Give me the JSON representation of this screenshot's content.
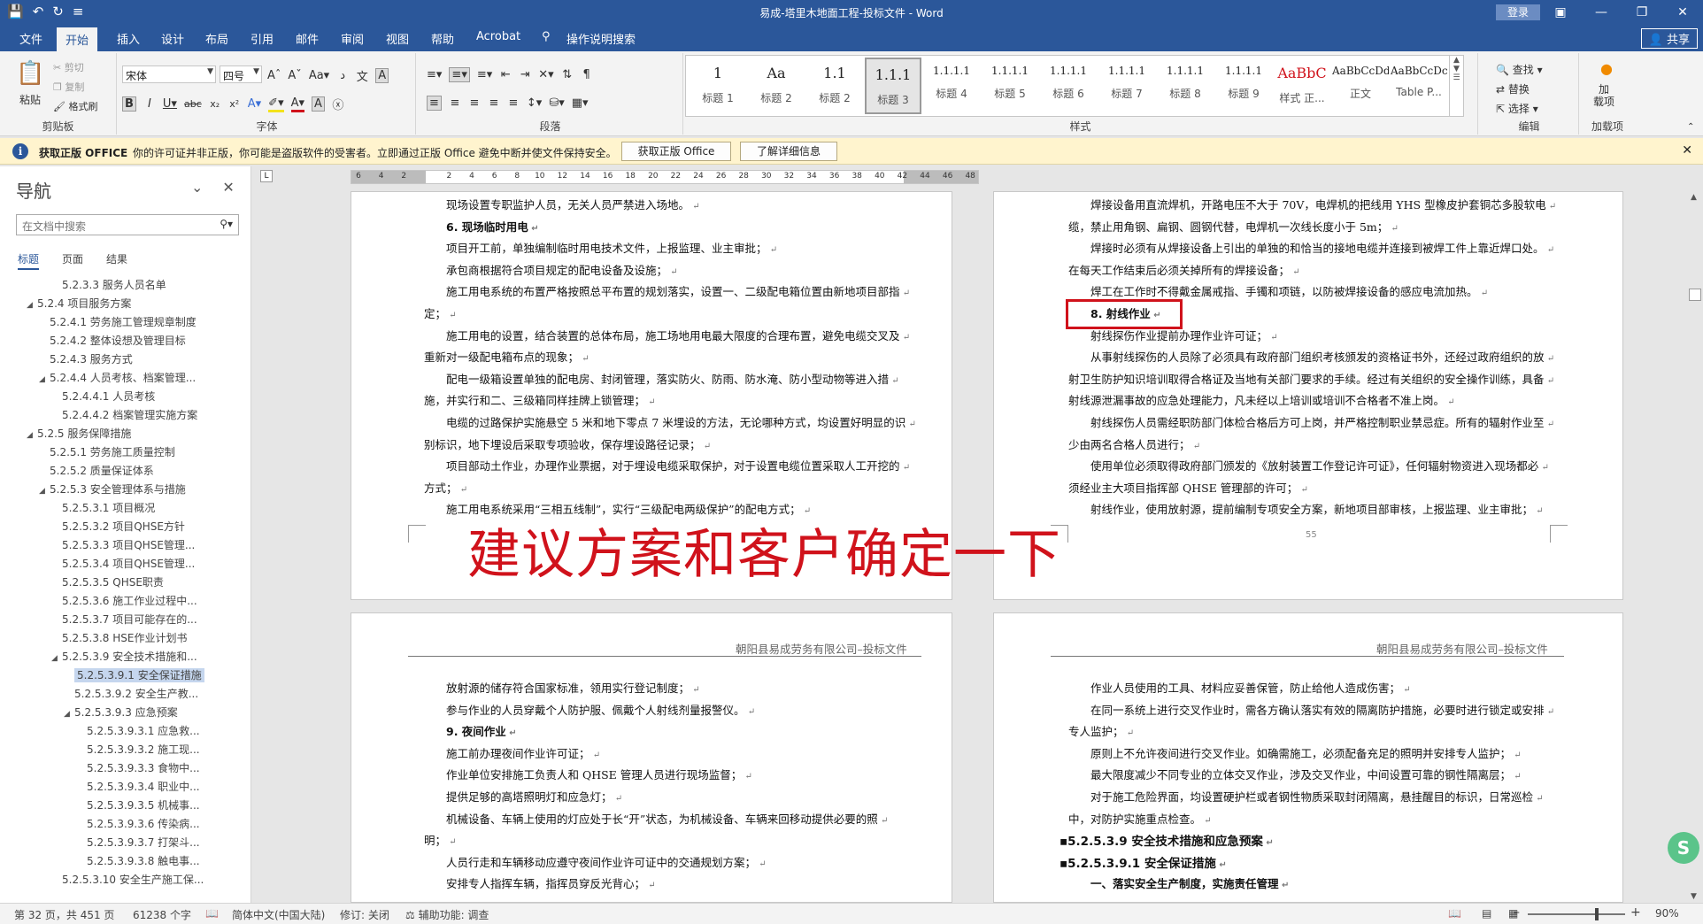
{
  "window": {
    "title": "易成-塔里木地面工程-投标文件  -  Word",
    "login": "登录"
  },
  "tabs": [
    "文件",
    "开始",
    "插入",
    "设计",
    "布局",
    "引用",
    "邮件",
    "审阅",
    "视图",
    "帮助",
    "Acrobat",
    "操作说明搜索"
  ],
  "active_tab": "开始",
  "share": "共享",
  "ribbon": {
    "clipboard": {
      "paste": "粘贴",
      "cut": "剪切",
      "copy": "复制",
      "format_painter": "格式刷",
      "label": "剪贴板"
    },
    "font": {
      "name": "宋体",
      "size": "四号",
      "label": "字体"
    },
    "paragraph": {
      "label": "段落"
    },
    "styles": {
      "label": "样式",
      "items": [
        {
          "sample": "1",
          "name": "标题 1"
        },
        {
          "sample": "Aa",
          "name": "标题 2"
        },
        {
          "sample": "1.1",
          "name": "标题 2"
        },
        {
          "sample": "1.1.1",
          "name": "标题 3"
        },
        {
          "sample": "1.1.1.1",
          "name": "标题 4"
        },
        {
          "sample": "1.1.1.1",
          "name": "标题 5"
        },
        {
          "sample": "1.1.1.1",
          "name": "标题 6"
        },
        {
          "sample": "1.1.1.1",
          "name": "标题 7"
        },
        {
          "sample": "1.1.1.1",
          "name": "标题 8"
        },
        {
          "sample": "1.1.1.1",
          "name": "标题 9"
        },
        {
          "sample": "AaBbC",
          "name": "样式 正..."
        },
        {
          "sample": "AaBbCcDdI",
          "name": "正文"
        },
        {
          "sample": "AaBbCcDc",
          "name": "Table P..."
        }
      ],
      "selected_index": 3
    },
    "editing": {
      "find": "查找",
      "replace": "替换",
      "select": "选择",
      "label": "编辑"
    },
    "addins": {
      "label": "加载项",
      "button": "加\n载项"
    }
  },
  "message_bar": {
    "heading": "获取正版 OFFICE",
    "text": "你的许可证并非正版，你可能是盗版软件的受害者。立即通过正版 Office 避免中断并使文件保持安全。",
    "btn_get": "获取正版 Office",
    "btn_more": "了解详细信息"
  },
  "nav": {
    "title": "导航",
    "search_placeholder": "在文档中搜索",
    "tabs": [
      "标题",
      "页面",
      "结果"
    ],
    "items": [
      {
        "text": "5.2.3.3 服务人员名单",
        "level": 4,
        "arrow": ""
      },
      {
        "text": "5.2.4 项目服务方案",
        "level": 2,
        "arrow": "◢"
      },
      {
        "text": "5.2.4.1 劳务施工管理规章制度",
        "level": 3,
        "arrow": ""
      },
      {
        "text": "5.2.4.2 整体设想及管理目标",
        "level": 3,
        "arrow": ""
      },
      {
        "text": "5.2.4.3 服务方式",
        "level": 3,
        "arrow": ""
      },
      {
        "text": "5.2.4.4 人员考核、档案管理...",
        "level": 3,
        "arrow": "◢"
      },
      {
        "text": "5.2.4.4.1 人员考核",
        "level": 4,
        "arrow": ""
      },
      {
        "text": "5.2.4.4.2 档案管理实施方案",
        "level": 4,
        "arrow": ""
      },
      {
        "text": "5.2.5 服务保障措施",
        "level": 2,
        "arrow": "◢"
      },
      {
        "text": "5.2.5.1 劳务施工质量控制",
        "level": 3,
        "arrow": ""
      },
      {
        "text": "5.2.5.2 质量保证体系",
        "level": 3,
        "arrow": ""
      },
      {
        "text": "5.2.5.3 安全管理体系与措施",
        "level": 3,
        "arrow": "◢"
      },
      {
        "text": "5.2.5.3.1 项目概况",
        "level": 4,
        "arrow": ""
      },
      {
        "text": "5.2.5.3.2 项目QHSE方针",
        "level": 4,
        "arrow": ""
      },
      {
        "text": "5.2.5.3.3 项目QHSE管理...",
        "level": 4,
        "arrow": ""
      },
      {
        "text": "5.2.5.3.4 项目QHSE管理...",
        "level": 4,
        "arrow": ""
      },
      {
        "text": "5.2.5.3.5 QHSE职责",
        "level": 4,
        "arrow": ""
      },
      {
        "text": "5.2.5.3.6 施工作业过程中...",
        "level": 4,
        "arrow": ""
      },
      {
        "text": "5.2.5.3.7 项目可能存在的...",
        "level": 4,
        "arrow": ""
      },
      {
        "text": "5.2.5.3.8 HSE作业计划书",
        "level": 4,
        "arrow": ""
      },
      {
        "text": "5.2.5.3.9 安全技术措施和...",
        "level": 4,
        "arrow": "◢"
      },
      {
        "text": "5.2.5.3.9.1 安全保证措施",
        "level": 5,
        "arrow": "",
        "selected": true
      },
      {
        "text": "5.2.5.3.9.2 安全生产教...",
        "level": 5,
        "arrow": ""
      },
      {
        "text": "5.2.5.3.9.3 应急预案",
        "level": 5,
        "arrow": "◢"
      },
      {
        "text": "5.2.5.3.9.3.1 应急救...",
        "level": 6,
        "arrow": ""
      },
      {
        "text": "5.2.5.3.9.3.2 施工现...",
        "level": 6,
        "arrow": ""
      },
      {
        "text": "5.2.5.3.9.3.3 食物中...",
        "level": 6,
        "arrow": ""
      },
      {
        "text": "5.2.5.3.9.3.4 职业中...",
        "level": 6,
        "arrow": ""
      },
      {
        "text": "5.2.5.3.9.3.5 机械事...",
        "level": 6,
        "arrow": ""
      },
      {
        "text": "5.2.5.3.9.3.6 传染病...",
        "level": 6,
        "arrow": ""
      },
      {
        "text": "5.2.5.3.9.3.7 打架斗...",
        "level": 6,
        "arrow": ""
      },
      {
        "text": "5.2.5.3.9.3.8 触电事...",
        "level": 6,
        "arrow": ""
      },
      {
        "text": "5.2.5.3.10 安全生产施工保...",
        "level": 4,
        "arrow": ""
      }
    ]
  },
  "ruler_numbers": [
    "6",
    "4",
    "2",
    "",
    "2",
    "4",
    "6",
    "8",
    "10",
    "12",
    "14",
    "16",
    "18",
    "20",
    "22",
    "24",
    "26",
    "28",
    "30",
    "32",
    "34",
    "36",
    "38",
    "40",
    "42",
    "44",
    "46",
    "48"
  ],
  "pages": {
    "p1": {
      "lines": [
        {
          "text": "现场设置专职监护人员，无关人员严禁进入场地。",
          "bold": false,
          "indent": true
        },
        {
          "text": "6. 现场临时用电",
          "bold": true,
          "indent": true
        },
        {
          "text": "项目开工前，单独编制临时用电技术文件，上报监理、业主审批；",
          "bold": false,
          "indent": true
        },
        {
          "text": "承包商根据符合项目规定的配电设备及设施；",
          "bold": false,
          "indent": true
        },
        {
          "text": "施工用电系统的布置严格按照总平布置的规划落实，设置一、二级配电箱位置由新地项目部指",
          "bold": false,
          "indent": true
        },
        {
          "text": "定；",
          "bold": false,
          "indent": false
        },
        {
          "text": "施工用电的设置，结合装置的总体布局，施工场地用电最大限度的合理布置，避免电缆交叉及",
          "bold": false,
          "indent": true
        },
        {
          "text": "重新对一级配电箱布点的现象；",
          "bold": false,
          "indent": false
        },
        {
          "text": "配电一级箱设置单独的配电房、封闭管理，落实防火、防雨、防水淹、防小型动物等进入措",
          "bold": false,
          "indent": true
        },
        {
          "text": "施，并实行和二、三级箱同样挂牌上锁管理；",
          "bold": false,
          "indent": false
        },
        {
          "text": "电缆的过路保护实施悬空 5 米和地下零点 7 米埋设的方法，无论哪种方式，均设置好明显的识",
          "bold": false,
          "indent": true
        },
        {
          "text": "别标识，地下埋设后采取专项验收，保存埋设路径记录；",
          "bold": false,
          "indent": false
        },
        {
          "text": "项目部动土作业，办理作业票据，对于埋设电缆采取保护，对于设置电缆位置采取人工开挖的",
          "bold": false,
          "indent": true
        },
        {
          "text": "方式；",
          "bold": false,
          "indent": false
        },
        {
          "text": "施工用电系统采用“三相五线制”，实行“三级配电两级保护”的配电方式；",
          "bold": false,
          "indent": true
        }
      ]
    },
    "p2": {
      "page_number": "55",
      "lines": [
        {
          "text": "焊接设备用直流焊机，开路电压不大于 70V，电焊机的把线用 YHS 型橡皮护套铜芯多股软电",
          "bold": false,
          "indent": true
        },
        {
          "text": "缆，禁止用角钢、扁钢、圆钢代替，电焊机一次线长度小于 5m；",
          "bold": false,
          "indent": false
        },
        {
          "text": "焊接时必须有从焊接设备上引出的单独的和恰当的接地电缆并连接到被焊工件上靠近焊口处。",
          "bold": false,
          "indent": true
        },
        {
          "text": "在每天工作结束后必须关掉所有的焊接设备；",
          "bold": false,
          "indent": false
        },
        {
          "text": "焊工在工作时不得戴金属戒指、手镯和项链，以防被焊接设备的感应电流加热。",
          "bold": false,
          "indent": true
        },
        {
          "text": "8. 射线作业",
          "bold": true,
          "indent": true
        },
        {
          "text": "射线探伤作业提前办理作业许可证；",
          "bold": false,
          "indent": true
        },
        {
          "text": "从事射线探伤的人员除了必须具有政府部门组织考核颁发的资格证书外，还经过政府组织的放",
          "bold": false,
          "indent": true
        },
        {
          "text": "射卫生防护知识培训取得合格证及当地有关部门要求的手续。经过有关组织的安全操作训练，具备",
          "bold": false,
          "indent": false
        },
        {
          "text": "射线源泄漏事故的应急处理能力，凡未经以上培训或培训不合格者不准上岗。",
          "bold": false,
          "indent": false
        },
        {
          "text": "射线探伤人员需经职防部门体检合格后方可上岗，并严格控制职业禁忌症。所有的辐射作业至",
          "bold": false,
          "indent": true
        },
        {
          "text": "少由两名合格人员进行；",
          "bold": false,
          "indent": false
        },
        {
          "text": "使用单位必须取得政府部门颁发的《放射装置工作登记许可证》，任何辐射物资进入现场都必",
          "bold": false,
          "indent": true
        },
        {
          "text": "须经业主大项目指挥部 QHSE 管理部的许可；",
          "bold": false,
          "indent": false
        },
        {
          "text": "射线作业，使用放射源，提前编制专项安全方案，新地项目部审核，上报监理、业主审批；",
          "bold": false,
          "indent": true
        }
      ]
    },
    "p3": {
      "header": "朝阳县易成劳务有限公司–投标文件",
      "lines": [
        {
          "text": "放射源的储存符合国家标准，领用实行登记制度；",
          "bold": false,
          "indent": true
        },
        {
          "text": "参与作业的人员穿戴个人防护服、佩戴个人射线剂量报警仪。",
          "bold": false,
          "indent": true
        },
        {
          "text": "9. 夜间作业",
          "bold": true,
          "indent": true
        },
        {
          "text": "施工前办理夜间作业许可证；",
          "bold": false,
          "indent": true
        },
        {
          "text": "作业单位安排施工负责人和 QHSE 管理人员进行现场监督；",
          "bold": false,
          "indent": true
        },
        {
          "text": "提供足够的高塔照明灯和应急灯；",
          "bold": false,
          "indent": true
        },
        {
          "text": "机械设备、车辆上使用的灯应处于长“开”状态，为机械设备、车辆来回移动提供必要的照",
          "bold": false,
          "indent": true
        },
        {
          "text": "明；",
          "bold": false,
          "indent": false
        },
        {
          "text": "人员行走和车辆移动应遵守夜间作业许可证中的交通规划方案；",
          "bold": false,
          "indent": true
        },
        {
          "text": "安排专人指挥车辆，指挥员穿反光背心；",
          "bold": false,
          "indent": true
        }
      ]
    },
    "p4": {
      "header": "朝阳县易成劳务有限公司–投标文件",
      "lines": [
        {
          "text": "作业人员使用的工具、材料应妥善保管，防止给他人造成伤害；",
          "bold": false,
          "indent": true
        },
        {
          "text": "在同一系统上进行交叉作业时，需各方确认落实有效的隔离防护措施，必要时进行锁定或安排",
          "bold": false,
          "indent": true
        },
        {
          "text": "专人监护；",
          "bold": false,
          "indent": false
        },
        {
          "text": "原则上不允许夜间进行交叉作业。如确需施工，必须配备充足的照明并安排专人监护；",
          "bold": false,
          "indent": true
        },
        {
          "text": "最大限度减少不同专业的立体交叉作业，涉及交叉作业，中间设置可靠的钢性隔离层；",
          "bold": false,
          "indent": true
        },
        {
          "text": "对于施工危险界面，均设置硬护栏或者钢性物质采取封闭隔离，悬挂醒目的标识，日常巡检",
          "bold": false,
          "indent": true
        },
        {
          "text": "中，对防护实施重点检查。",
          "bold": false,
          "indent": false
        },
        {
          "text": "5.2.5.3.9  安全技术措施和应急预案",
          "bold": true,
          "heading": true,
          "indent": false
        },
        {
          "text": "5.2.5.3.9.1    安全保证措施",
          "bold": true,
          "heading": true,
          "indent": false
        },
        {
          "text": "一、落实安全生产制度，实施责任管理",
          "bold": true,
          "indent": true
        }
      ]
    }
  },
  "annotation": {
    "text": "建议方案和客户确定一下"
  },
  "status": {
    "page": "第 32 页，共 451 页",
    "words": "61238 个字",
    "language": "简体中文(中国大陆)",
    "track": "修订: 关闭",
    "accessibility": "辅助功能: 调查",
    "zoom": "90%"
  }
}
